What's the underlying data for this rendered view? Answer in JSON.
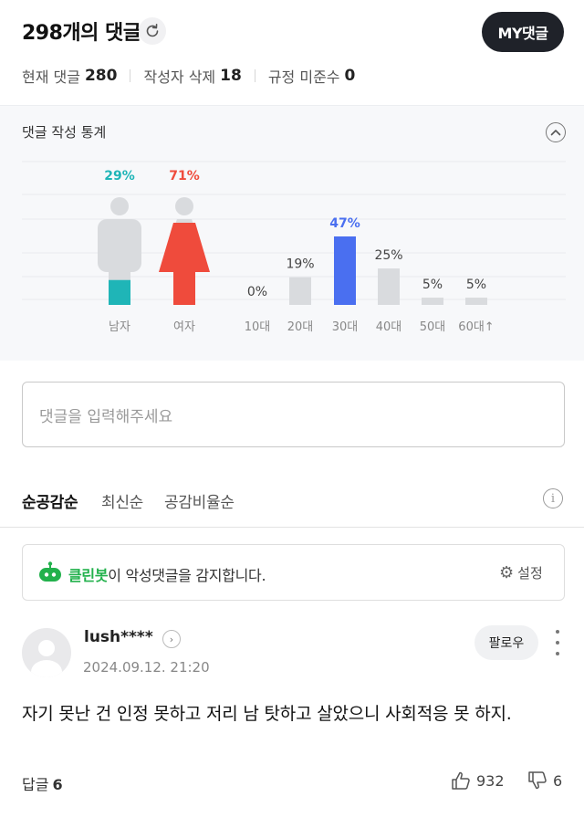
{
  "header": {
    "count_title": "298개의 댓글",
    "my_comments_label": "MY댓글",
    "stats": [
      {
        "label": "현재 댓글",
        "value": "280"
      },
      {
        "label": "작성자 삭제",
        "value": "18"
      },
      {
        "label": "규정 미준수",
        "value": "0"
      }
    ]
  },
  "stat_panel": {
    "title": "댓글 작성 통계"
  },
  "chart_data": {
    "type": "bar",
    "gender": {
      "categories": [
        "남자",
        "여자"
      ],
      "values": [
        29,
        71
      ],
      "value_labels": [
        "29%",
        "71%"
      ],
      "colors": [
        "#1fb5b7",
        "#ef4b3c"
      ]
    },
    "age": {
      "categories": [
        "10대",
        "20대",
        "30대",
        "40대",
        "50대",
        "60대↑"
      ],
      "values": [
        0,
        19,
        47,
        25,
        5,
        5
      ],
      "value_labels": [
        "0%",
        "19%",
        "47%",
        "25%",
        "5%",
        "5%"
      ],
      "highlight_color": "#4a6ff0",
      "bar_color": "#d9dbde",
      "highlight_index": 2
    },
    "grid": true
  },
  "comment_input": {
    "placeholder": "댓글을 입력해주세요"
  },
  "sort_tabs": [
    "순공감순",
    "최신순",
    "공감비율순"
  ],
  "cleanbot": {
    "brand": "클린봇",
    "message": "이 악성댓글을 감지합니다.",
    "settings_label": "설정"
  },
  "comment": {
    "username": "lush****",
    "timestamp": "2024.09.12. 21:20",
    "follow_label": "팔로우",
    "body": "자기 못난 건 인정 못하고 저리 남 탓하고 살았으니 사회적응 못 하지.",
    "reply_label": "답글",
    "reply_count": "6",
    "likes": "932",
    "dislikes": "6"
  }
}
